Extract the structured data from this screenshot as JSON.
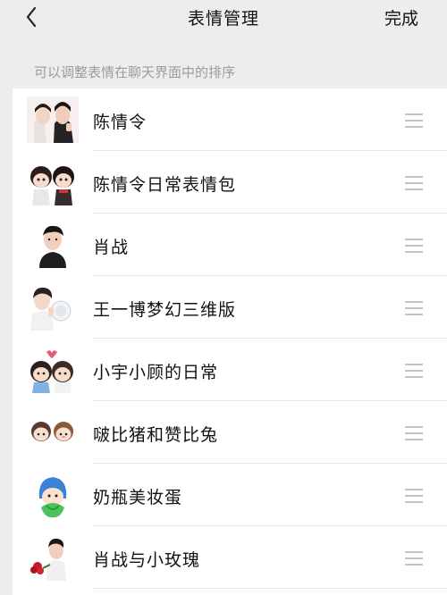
{
  "navbar": {
    "title": "表情管理",
    "done_label": "完成",
    "back_icon": "chevron-left-icon"
  },
  "hint": "可以调整表情在聊天界面中的排序",
  "handle_icon": "drag-handle-icon",
  "colors": {
    "background": "#ededed",
    "list_background": "#ffffff",
    "hint_text": "#9c9c9c",
    "handle": "#c4c4c4"
  },
  "packs": [
    {
      "label": "陈情令"
    },
    {
      "label": "陈情令日常表情包"
    },
    {
      "label": "肖战"
    },
    {
      "label": "王一博梦幻三维版"
    },
    {
      "label": "小宇小顾的日常"
    },
    {
      "label": "啵比猪和赞比兔"
    },
    {
      "label": "奶瓶美妆蛋"
    },
    {
      "label": "肖战与小玫瑰"
    }
  ]
}
